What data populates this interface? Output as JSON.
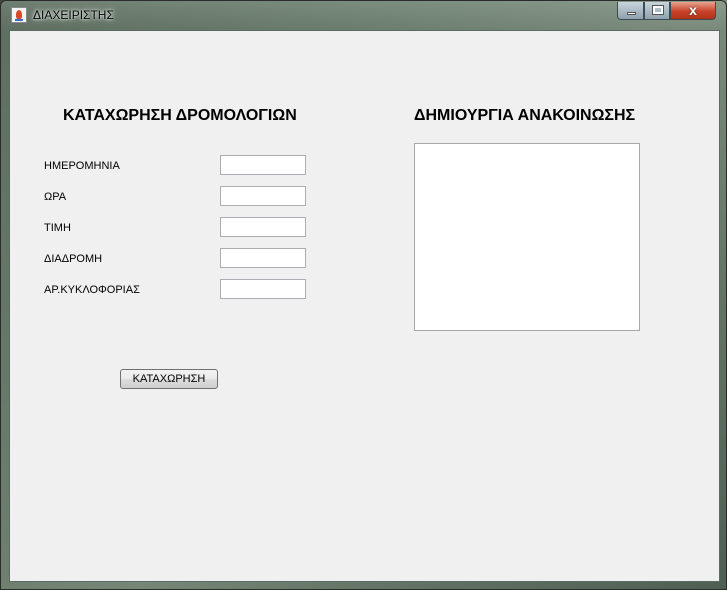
{
  "window": {
    "title": "ΔΙΑΧΕΙΡΙΣΤΗΣ",
    "close_glyph": "x"
  },
  "route_form": {
    "heading": "ΚΑΤΑΧΩΡΗΣΗ ΔΡΟΜΟΛΟΓΙΩΝ",
    "fields": [
      {
        "label": "ΗΜΕΡΟΜΗΝΙΑ",
        "value": ""
      },
      {
        "label": "ΩΡΑ",
        "value": ""
      },
      {
        "label": "ΤΙΜΗ",
        "value": ""
      },
      {
        "label": "ΔΙΑΔΡΟΜΗ",
        "value": ""
      },
      {
        "label": "ΑΡ.ΚΥΚΛΟΦΟΡΙΑΣ",
        "value": ""
      }
    ],
    "submit_label": "ΚΑΤΑΧΩΡΗΣΗ"
  },
  "announcement": {
    "heading": "ΔΗΜΙΟΥΡΓΙΑ ΑΝΑΚΟΙΝΩΣΗΣ",
    "text": ""
  },
  "icons": {
    "app": "java-app-icon",
    "minimize": "minimize-icon",
    "maximize": "maximize-icon",
    "close": "close-icon"
  }
}
